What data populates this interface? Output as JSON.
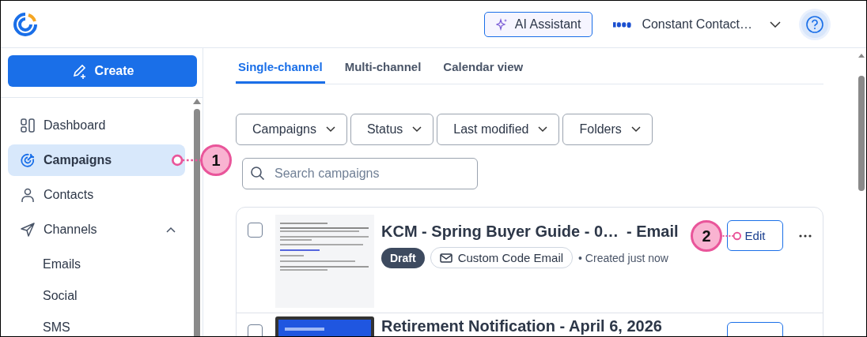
{
  "header": {
    "ai_button": "AI Assistant",
    "account": "Constant Contact…"
  },
  "sidebar": {
    "create": "Create",
    "items": [
      {
        "label": "Dashboard",
        "selected": false
      },
      {
        "label": "Campaigns",
        "selected": true
      },
      {
        "label": "Contacts",
        "selected": false
      },
      {
        "label": "Channels",
        "selected": false,
        "expanded": true,
        "children": [
          {
            "label": "Emails",
            "selected": false
          },
          {
            "label": "Social",
            "selected": false
          },
          {
            "label": "SMS",
            "selected": false
          }
        ]
      }
    ]
  },
  "tabs": [
    {
      "label": "Single-channel",
      "selected": true
    },
    {
      "label": "Multi-channel",
      "selected": false
    },
    {
      "label": "Calendar view",
      "selected": false
    }
  ],
  "filters": [
    "Campaigns",
    "Status",
    "Last modified",
    "Folders"
  ],
  "search": {
    "placeholder": "Search campaigns"
  },
  "campaigns": [
    {
      "title": "KCM - Spring Buyer Guide - 0…",
      "suffix": "- Email",
      "status": "Draft",
      "type": "Custom Code Email",
      "created": "• Created just now",
      "action": "Edit",
      "checked": false
    },
    {
      "title": "Retirement Notification - April 6, 2026",
      "checked": false
    }
  ],
  "callouts": [
    "1",
    "2"
  ]
}
